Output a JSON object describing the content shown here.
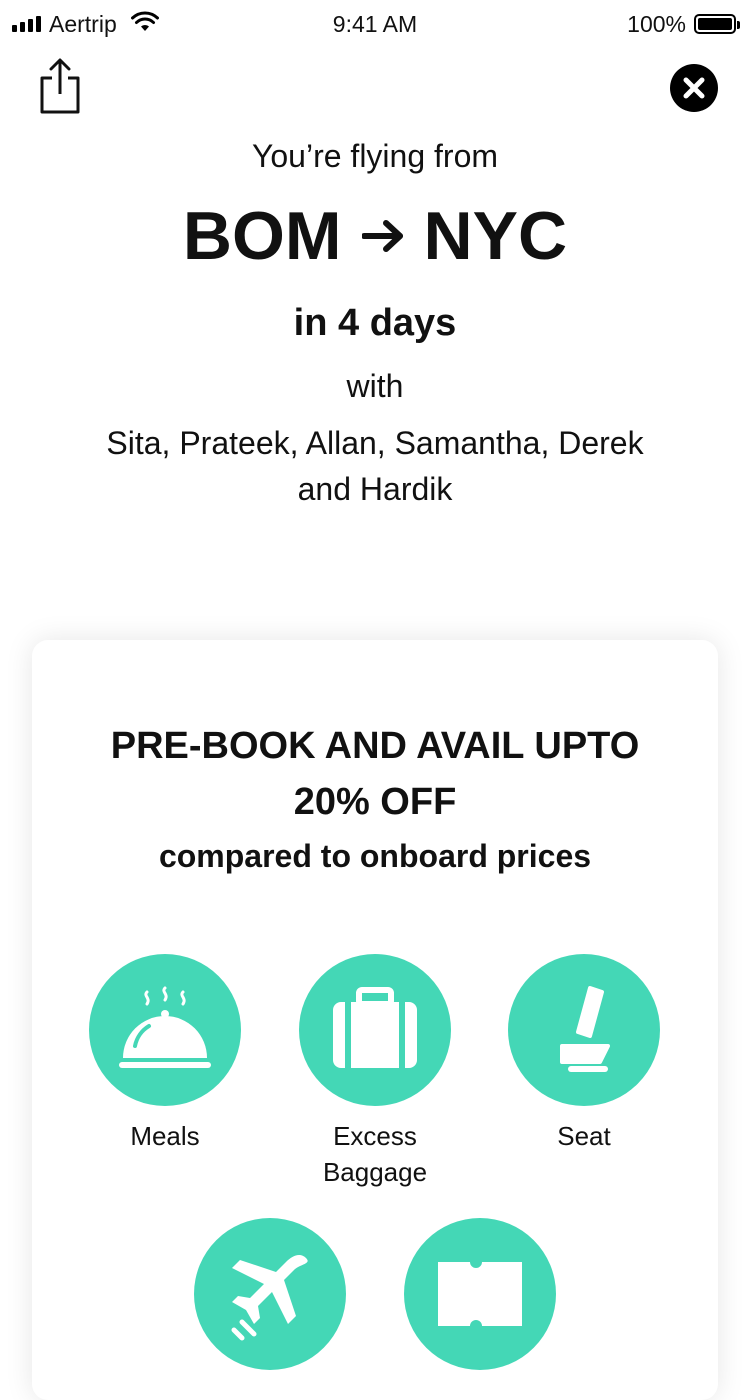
{
  "status_bar": {
    "carrier": "Aertrip",
    "time": "9:41 AM",
    "battery": "100%"
  },
  "header": {
    "intro": "You’re flying from",
    "origin": "BOM",
    "destination": "NYC",
    "duration": "in 4 days",
    "with": "with",
    "travellers": "Sita, Prateek, Allan, Samantha, Derek and Hardik"
  },
  "icons": {
    "share": "share-icon",
    "close": "close-icon",
    "arrow": "arrow-right-icon"
  },
  "promo": {
    "title": "PRE-BOOK AND AVAIL UPTO 20% OFF",
    "subtitle": "compared to onboard prices"
  },
  "addons": [
    {
      "label": "Meals",
      "icon": "meal-cloche-icon"
    },
    {
      "label": "Excess Baggage",
      "icon": "suitcase-icon"
    },
    {
      "label": "Seat",
      "icon": "seat-icon"
    },
    {
      "label": "",
      "icon": "plane-tools-icon"
    },
    {
      "label": "",
      "icon": "ticket-icon"
    }
  ],
  "colors": {
    "accent": "#44d7b6",
    "text": "#111111",
    "background": "#ffffff"
  }
}
